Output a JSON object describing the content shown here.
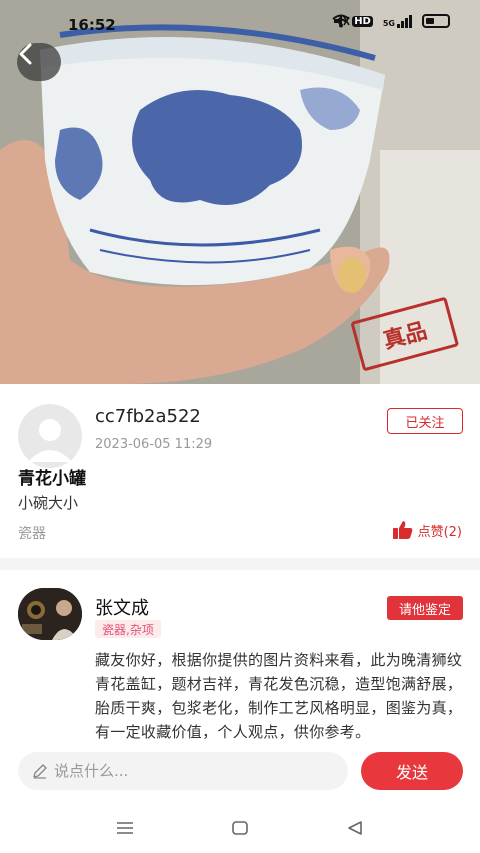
{
  "status_bar": {
    "time": "16:52",
    "icons": [
      "mute-icon",
      "wifi-icon",
      "hd-icon",
      "signal-5g-icon",
      "battery-icon"
    ],
    "hd_label": "HD",
    "network_label": "5G"
  },
  "hero": {
    "stamp_text": "真品",
    "back_icon": "chevron-left-icon"
  },
  "post": {
    "username": "cc7fb2a522",
    "time": "2023-06-05 11:29",
    "follow_label": "已关注",
    "title": "青花小罐",
    "description": "小碗大小",
    "category": "瓷器",
    "like_label": "点赞(2)"
  },
  "answer": {
    "expert_name": "张文成",
    "expert_tag": "瓷器,杂项",
    "ask_label": "请他鉴定",
    "text": "藏友你好，根据你提供的图片资料来看，此为晚清狮纹青花盖缸，题材吉祥，青花发色沉稳，造型饱满舒展，胎质干爽，包浆老化，制作工艺风格明显，图鉴为真，有一定收藏价值，个人观点，供你参考。"
  },
  "comment_bar": {
    "placeholder": "说点什么...",
    "send_label": "发送"
  },
  "colors": {
    "accent_red": "#e0333a",
    "tag_pink": "#e0567a"
  }
}
